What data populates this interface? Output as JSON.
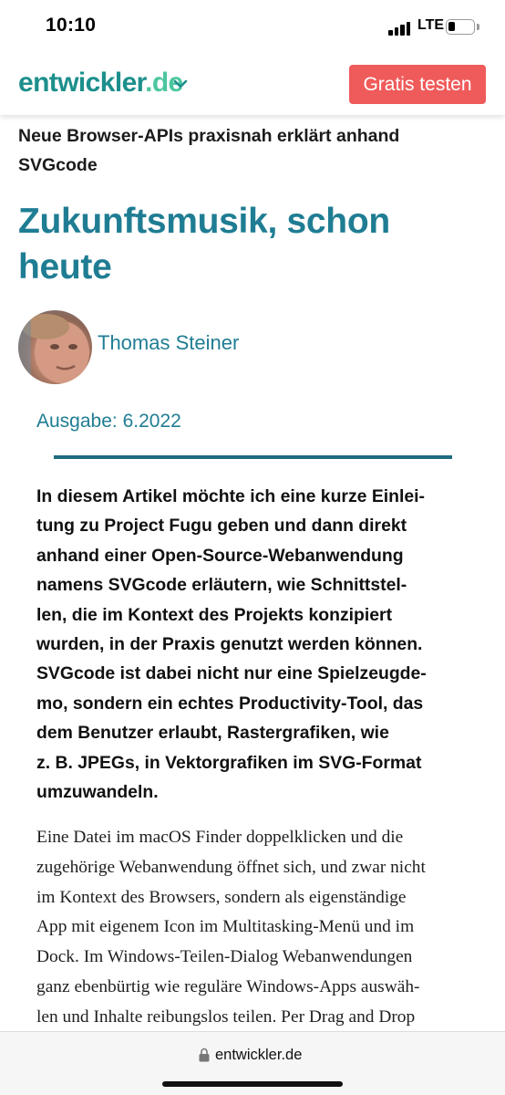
{
  "status_bar": {
    "time": "10:10",
    "network": "LTE",
    "battery_level": 0.25
  },
  "header": {
    "logo_part1": "entwickler",
    "logo_part2": ".de",
    "cta_label": "Gratis testen",
    "colors": {
      "logo_primary": "#1c8f8c",
      "logo_accent": "#4cc6a0",
      "cta": "#ef5b5a"
    }
  },
  "article": {
    "kicker_lines": [
      "Neue Browser-APIs praxisnah erklärt anhand",
      "SVGcode"
    ],
    "title_lines": [
      "Zukunftsmusik, schon",
      "heute"
    ],
    "author": "Thomas Steiner",
    "issue": "Ausgabe: 6.2022",
    "lead_lines": [
      "In diesem Artikel möchte ich eine kurze Einlei-",
      "tung zu Project Fugu geben und dann direkt",
      "anhand einer Open-Source-Webanwendung",
      "namens SVGcode erläutern, wie Schnittstel-",
      "len, die im Kontext des Projekts konzipiert",
      "wurden, in der Praxis genutzt werden können.",
      "SVGcode ist dabei nicht nur eine Spielzeugde-",
      "mo, sondern ein echtes Productivity-Tool, das",
      "dem Benutzer erlaubt, Rastergrafiken, wie",
      "z. B. JPEGs, in Vektorgrafiken im SVG-Format",
      "umzuwandeln."
    ],
    "body_lines": [
      "Eine Datei im macOS Finder doppelklicken und die",
      "zugehörige Webanwendung öffnet sich, und zwar nicht",
      "im Kontext des Browsers, sondern als eigenständige",
      "App mit eigenem Icon im Multitasking-Menü und im",
      "Dock. Im Windows-Teilen-Dialog Webanwendungen",
      "ganz ebenbürtig wie reguläre Windows-Apps auswäh-",
      "len und Inhalte reibungslos teilen. Per Drag and Drop"
    ],
    "accent_color": "#1f7d93"
  },
  "url_bar": {
    "url": "entwickler.de",
    "icon": "lock-icon"
  }
}
